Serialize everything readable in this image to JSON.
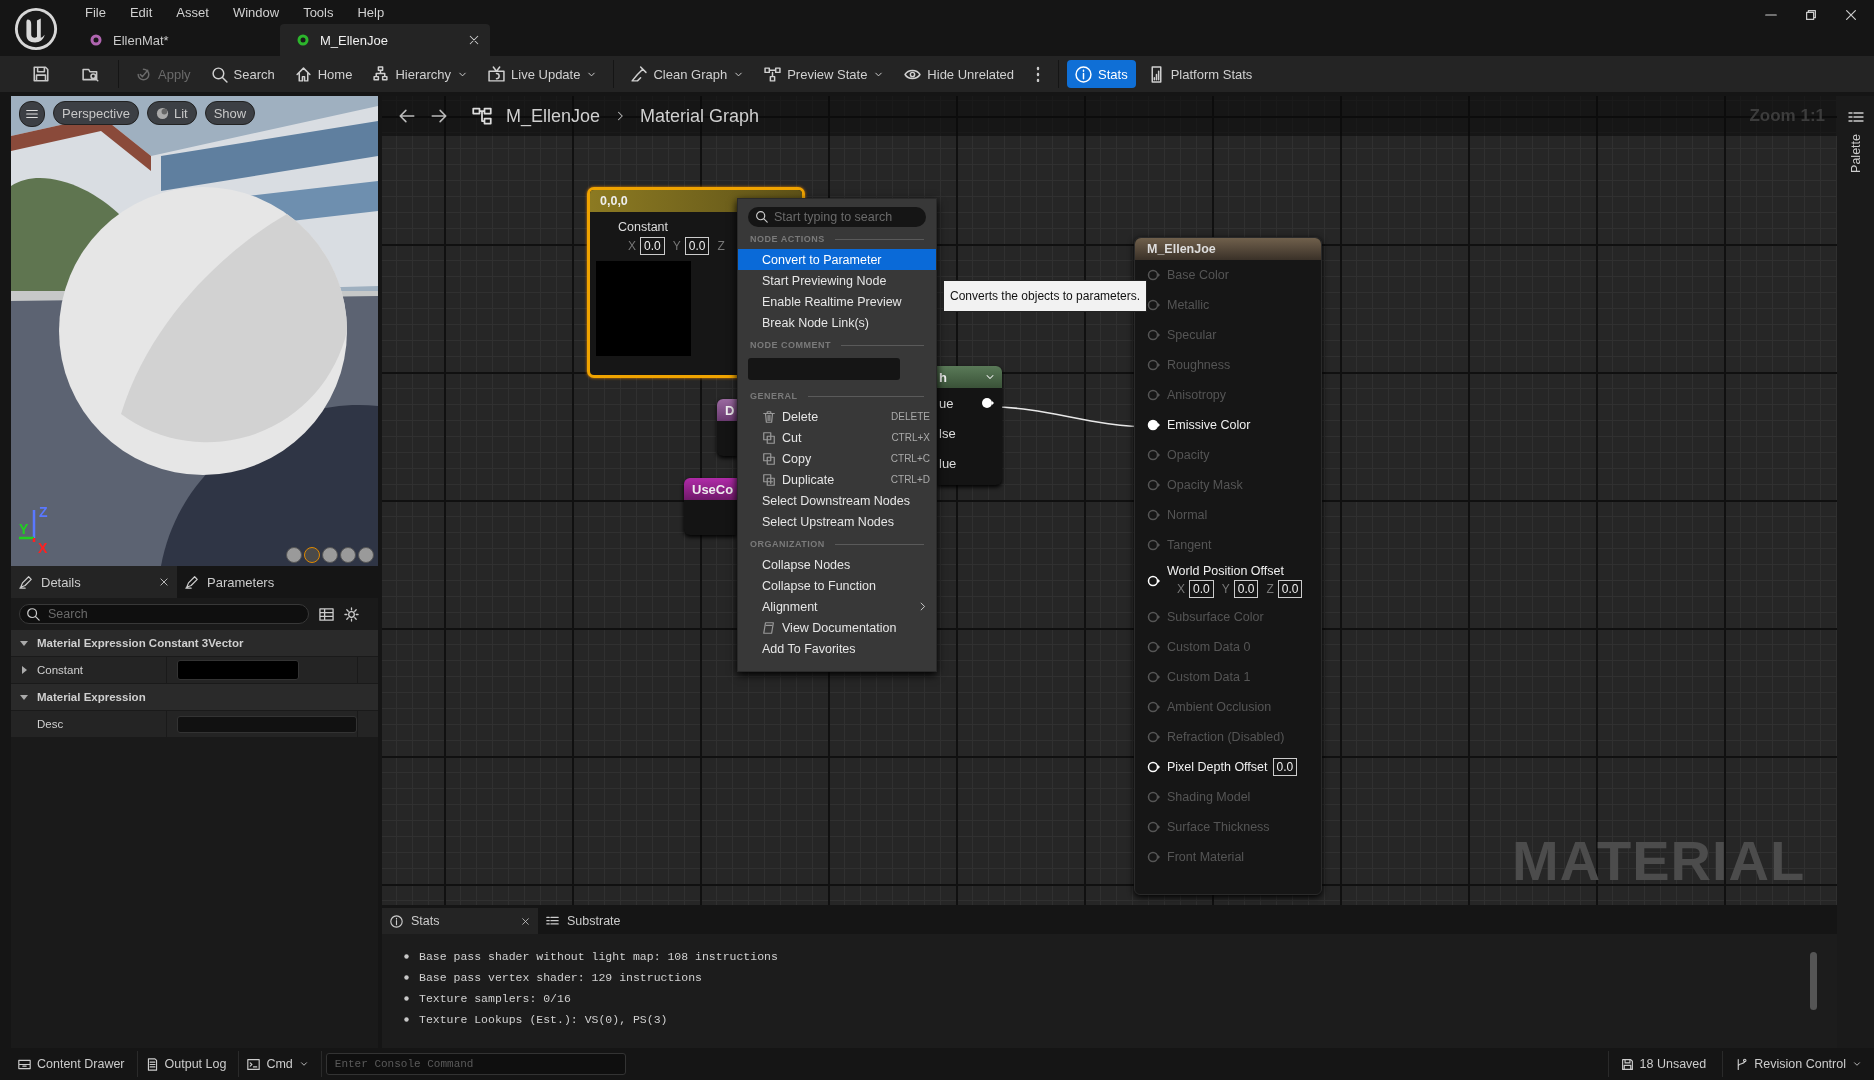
{
  "menu": [
    "File",
    "Edit",
    "Asset",
    "Window",
    "Tools",
    "Help"
  ],
  "tabs": [
    {
      "label": "EllenMat*",
      "selected": false
    },
    {
      "label": "M_EllenJoe",
      "selected": true
    }
  ],
  "toolbar": {
    "groups": [
      {
        "items": [
          {
            "kind": "icon"
          },
          {
            "kind": "icon"
          }
        ]
      },
      {
        "items": [
          {
            "kind": "button",
            "label": "Apply",
            "disabled": true,
            "selected": false
          },
          {
            "kind": "button",
            "label": "Search",
            "disabled": false,
            "selected": false
          },
          {
            "kind": "button",
            "label": "Home",
            "disabled": false,
            "selected": false
          },
          {
            "kind": "dropdown",
            "label": "Hierarchy",
            "disabled": false,
            "selected": false
          },
          {
            "kind": "dropdown",
            "label": "Live Update",
            "disabled": false,
            "selected": false
          }
        ]
      },
      {
        "items": [
          {
            "kind": "dropdown",
            "label": "Clean Graph",
            "disabled": false,
            "selected": false
          },
          {
            "kind": "dropdown",
            "label": "Preview State",
            "disabled": false,
            "selected": false
          },
          {
            "kind": "button",
            "label": "Hide Unrelated",
            "disabled": false,
            "selected": false
          },
          {
            "kind": "more"
          }
        ]
      },
      {
        "items": [
          {
            "kind": "button",
            "label": "Stats",
            "disabled": false,
            "selected": true
          },
          {
            "kind": "button",
            "label": "Platform Stats",
            "disabled": false,
            "selected": false
          }
        ]
      }
    ]
  },
  "viewport": {
    "buttons": [
      "Perspective",
      "Lit",
      "Show"
    ],
    "gizmo_axes": [
      {
        "label": "Z",
        "color": "#5a78ff"
      },
      {
        "label": "Y",
        "color": "#20d020"
      },
      {
        "label": "X",
        "color": "#ff2020"
      }
    ],
    "preview_meshes": [
      {
        "selected": false
      },
      {
        "selected": true
      },
      {
        "selected": false
      },
      {
        "selected": false
      },
      {
        "selected": false
      }
    ]
  },
  "details": {
    "tabs": [
      {
        "label": "Details",
        "selected": true
      },
      {
        "label": "Parameters",
        "selected": false
      }
    ],
    "search": {
      "placeholder": "Search"
    },
    "sections": [
      {
        "title": "Material Expression Constant 3Vector",
        "expanded": true,
        "rows": [
          {
            "label": "Constant",
            "kind": "color",
            "expanded": false
          }
        ]
      },
      {
        "title": "Material Expression",
        "expanded": true,
        "rows": [
          {
            "label": "Desc",
            "kind": "text"
          }
        ]
      }
    ]
  },
  "graph": {
    "breadcrumb": [
      "M_EllenJoe",
      "Material Graph"
    ],
    "zoom": "Zoom 1:1",
    "watermark": "MATERIAL",
    "palette": "Palette",
    "constant_node": {
      "title": "0,0,0",
      "selected": true,
      "label": "Constant",
      "fields": [
        {
          "axis": "X",
          "value": "0.0"
        },
        {
          "axis": "Y",
          "value": "0.0"
        },
        {
          "axis": "Z"
        }
      ]
    },
    "partial_nodes": [
      {
        "kind": "d_node",
        "title": "D"
      },
      {
        "kind": "use_node",
        "title": "UseCo"
      },
      {
        "kind": "switch_node",
        "title": "h",
        "pins": [
          "ue",
          "lse",
          "lue"
        ]
      }
    ],
    "context_menu": {
      "search": {
        "placeholder": "Start typing to search"
      },
      "sections": [
        {
          "heading": "NODE ACTIONS",
          "items": [
            {
              "label": "Convert to Parameter",
              "selected": true
            },
            {
              "label": "Start Previewing Node",
              "selected": false
            },
            {
              "label": "Enable Realtime Preview",
              "selected": false
            },
            {
              "label": "Break Node Link(s)",
              "selected": false
            }
          ]
        },
        {
          "heading": "NODE COMMENT",
          "kind": "comment"
        },
        {
          "heading": "GENERAL",
          "items": [
            {
              "label": "Delete",
              "shortcut": "DELETE",
              "selected": false
            },
            {
              "label": "Cut",
              "shortcut": "CTRL+X",
              "selected": false
            },
            {
              "label": "Copy",
              "shortcut": "CTRL+C",
              "selected": false
            },
            {
              "label": "Duplicate",
              "shortcut": "CTRL+D",
              "selected": false
            },
            {
              "label": "Select Downstream Nodes",
              "selected": false
            },
            {
              "label": "Select Upstream Nodes",
              "selected": false
            }
          ]
        },
        {
          "heading": "ORGANIZATION",
          "items": [
            {
              "label": "Collapse Nodes",
              "selected": false
            },
            {
              "label": "Collapse to Function",
              "selected": false
            },
            {
              "label": "Alignment",
              "selected": false,
              "submenu": true
            },
            {
              "label": "View Documentation",
              "selected": false
            },
            {
              "label": "Add To Favorites",
              "selected": false
            }
          ]
        }
      ]
    },
    "tooltip": "Converts the objects to parameters.",
    "material_node": {
      "title": "M_EllenJoe",
      "pins": [
        {
          "label": "Base Color",
          "active": false,
          "connected": false
        },
        {
          "label": "Metallic",
          "active": false,
          "connected": false
        },
        {
          "label": "Specular",
          "active": false,
          "connected": false
        },
        {
          "label": "Roughness",
          "active": false,
          "connected": false
        },
        {
          "label": "Anisotropy",
          "active": false,
          "connected": false
        },
        {
          "label": "Emissive Color",
          "active": true,
          "connected": true
        },
        {
          "label": "Opacity",
          "active": false,
          "connected": false
        },
        {
          "label": "Opacity Mask",
          "active": false,
          "connected": false
        },
        {
          "label": "Normal",
          "active": false,
          "connected": false
        },
        {
          "label": "Tangent",
          "active": false,
          "connected": false
        },
        {
          "label": "World Position Offset",
          "active": true,
          "connected": false,
          "fields": [
            {
              "axis": "X",
              "value": "0.0"
            },
            {
              "axis": "Y",
              "value": "0.0"
            },
            {
              "axis": "Z",
              "value": "0.0"
            }
          ]
        },
        {
          "label": "Subsurface Color",
          "active": false,
          "connected": false
        },
        {
          "label": "Custom Data 0",
          "active": false,
          "connected": false
        },
        {
          "label": "Custom Data 1",
          "active": false,
          "connected": false
        },
        {
          "label": "Ambient Occlusion",
          "active": false,
          "connected": false
        },
        {
          "label": "Refraction (Disabled)",
          "active": false,
          "connected": false
        },
        {
          "label": "Pixel Depth Offset",
          "active": true,
          "connected": false,
          "value": "0.0"
        },
        {
          "label": "Shading Model",
          "active": false,
          "connected": false
        },
        {
          "label": "Surface Thickness",
          "active": false,
          "connected": false
        },
        {
          "label": "Front Material",
          "active": false,
          "connected": false
        }
      ]
    }
  },
  "stats_panel": {
    "tabs": [
      {
        "label": "Stats",
        "selected": true
      },
      {
        "label": "Substrate",
        "selected": false
      }
    ],
    "lines": [
      "Base pass shader without light map: 108 instructions",
      "Base pass vertex shader: 129 instructions",
      "Texture samplers: 0/16",
      "Texture Lookups (Est.): VS(0), PS(3)"
    ]
  },
  "status_bar": {
    "left": [
      "Content Drawer",
      "Output Log",
      "Cmd"
    ],
    "console": {
      "placeholder": "Enter Console Command"
    },
    "right": [
      "18 Unsaved",
      "Revision Control"
    ]
  }
}
